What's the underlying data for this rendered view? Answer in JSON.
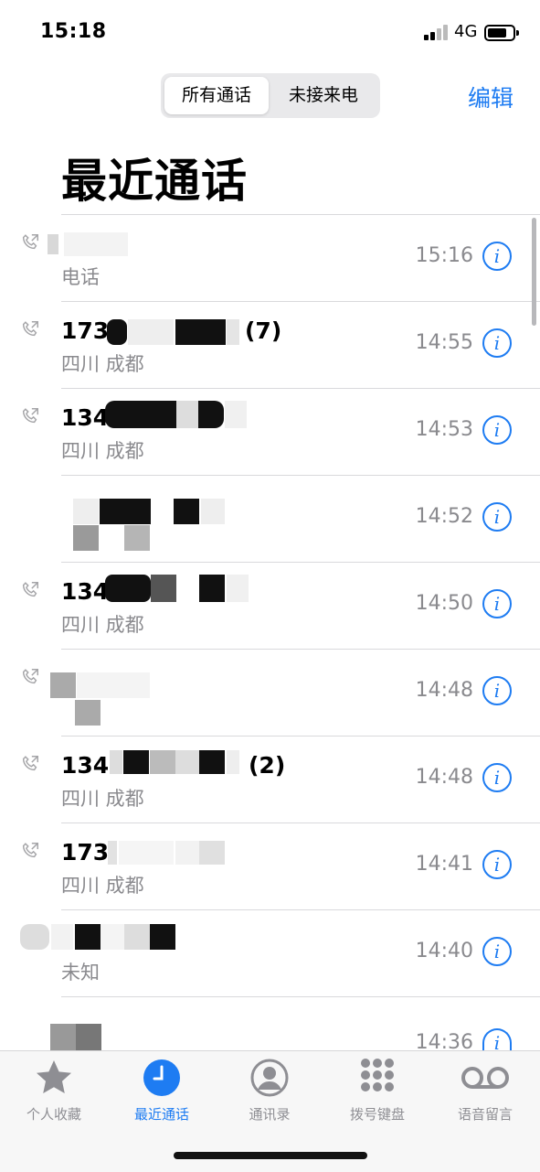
{
  "status_bar": {
    "time": "15:18",
    "network": "4G"
  },
  "segment": {
    "all_calls": "所有通话",
    "missed_calls": "未接来电"
  },
  "edit_label": "编辑",
  "title": "最近通话",
  "calls": [
    {
      "name": "",
      "count": "",
      "location": "电话",
      "time": "15:16"
    },
    {
      "name": "173",
      "count": "(7)",
      "location": "四川 成都",
      "time": "14:55"
    },
    {
      "name": "134",
      "count": "",
      "location": "四川 成都",
      "time": "14:53"
    },
    {
      "name": "",
      "count": "",
      "location": "",
      "time": "14:52"
    },
    {
      "name": "134",
      "count": "",
      "location": "四川 成都",
      "time": "14:50"
    },
    {
      "name": "",
      "count": "",
      "location": "",
      "time": "14:48"
    },
    {
      "name": "134",
      "count": "(2)",
      "location": "四川 成都",
      "time": "14:48"
    },
    {
      "name": "173",
      "count": "",
      "location": "四川 成都",
      "time": "14:41"
    },
    {
      "name": "",
      "count": "",
      "location": "未知",
      "time": "14:40"
    },
    {
      "name": "",
      "count": "",
      "location": "",
      "time": "14:36"
    }
  ],
  "info_glyph": "i",
  "tabs": [
    {
      "label": "个人收藏",
      "icon": "star-icon"
    },
    {
      "label": "最近通话",
      "icon": "clock-icon"
    },
    {
      "label": "通讯录",
      "icon": "person-circle-icon"
    },
    {
      "label": "拨号键盘",
      "icon": "keypad-icon"
    },
    {
      "label": "语音留言",
      "icon": "voicemail-icon"
    }
  ],
  "colors": {
    "accent": "#1e7cf2",
    "secondary_text": "#8a8a8e"
  }
}
